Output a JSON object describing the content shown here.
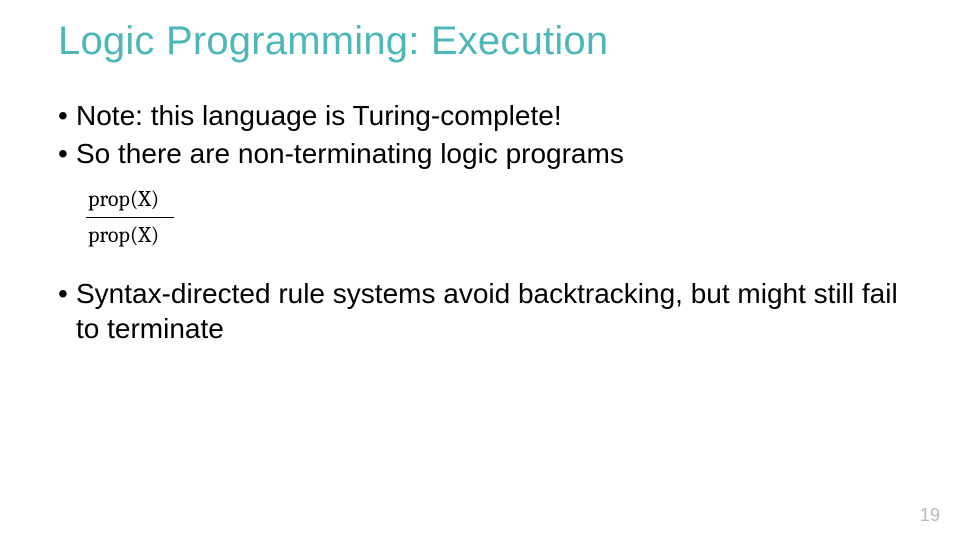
{
  "slide": {
    "title": "Logic Programming: Execution",
    "bullets": [
      "Note: this language is Turing-complete!",
      "So there are non-terminating logic programs"
    ],
    "rule": {
      "premise": "prop(X)",
      "conclusion": "prop(X)"
    },
    "bullets2": [
      "Syntax-directed rule systems avoid backtracking, but might still fail to terminate"
    ],
    "page_number": "19"
  }
}
